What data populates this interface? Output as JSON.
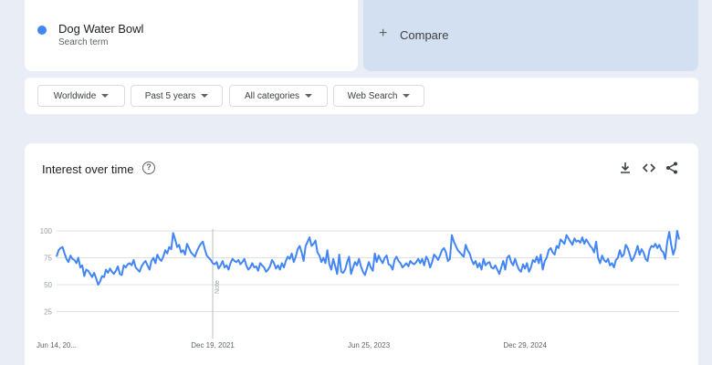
{
  "search_term": {
    "name": "Dog Water Bowl",
    "subtitle": "Search term",
    "color": "#4285f4"
  },
  "compare": {
    "plus": "+",
    "label": "Compare"
  },
  "filters": [
    {
      "label": "Worldwide"
    },
    {
      "label": "Past 5 years"
    },
    {
      "label": "All categories"
    },
    {
      "label": "Web Search"
    }
  ],
  "chart_panel": {
    "title": "Interest over time",
    "help_icon": "help-circle-icon",
    "tools": [
      "download-icon",
      "embed-code-icon",
      "share-icon"
    ]
  },
  "chart_data": {
    "type": "line",
    "title": "Interest over time",
    "xlabel": "",
    "ylabel": "",
    "ylim": [
      0,
      100
    ],
    "y_ticks": [
      25,
      50,
      75,
      100
    ],
    "x_tick_labels": [
      "Jun 14, 20...",
      "Dec 19, 2021",
      "Jun 25, 2023",
      "Dec 29, 2024"
    ],
    "x_tick_weeks": [
      0,
      79,
      158,
      237
    ],
    "note_label": "Note",
    "note_week": 79,
    "grid": true,
    "color": "#4285f4",
    "series": [
      {
        "values": [
          76,
          82,
          84,
          85,
          79,
          74,
          71,
          77,
          74,
          73,
          70,
          75,
          66,
          68,
          58,
          64,
          63,
          60,
          57,
          61,
          56,
          50,
          53,
          58,
          57,
          64,
          61,
          65,
          62,
          60,
          63,
          67,
          60,
          59,
          68,
          66,
          69,
          70,
          68,
          73,
          66,
          64,
          62,
          67,
          70,
          72,
          68,
          64,
          72,
          75,
          70,
          78,
          74,
          72,
          76,
          82,
          79,
          85,
          83,
          98,
          92,
          85,
          87,
          80,
          82,
          78,
          88,
          84,
          80,
          78,
          76,
          81,
          85,
          88,
          90,
          83,
          77,
          75,
          73,
          70,
          69,
          71,
          65,
          68,
          72,
          66,
          68,
          64,
          70,
          74,
          72,
          71,
          73,
          69,
          71,
          74,
          68,
          64,
          66,
          70,
          66,
          67,
          63,
          70,
          68,
          66,
          62,
          64,
          67,
          73,
          70,
          65,
          68,
          64,
          70,
          66,
          72,
          76,
          74,
          79,
          71,
          76,
          83,
          86,
          80,
          72,
          86,
          90,
          94,
          86,
          88,
          91,
          80,
          77,
          71,
          75,
          70,
          82,
          69,
          64,
          74,
          67,
          60,
          78,
          62,
          61,
          64,
          71,
          76,
          60,
          66,
          71,
          68,
          74,
          67,
          62,
          59,
          65,
          71,
          66,
          63,
          79,
          71,
          77,
          73,
          70,
          75,
          77,
          69,
          68,
          64,
          73,
          76,
          72,
          70,
          66,
          68,
          70,
          67,
          72,
          70,
          69,
          71,
          74,
          70,
          74,
          68,
          76,
          73,
          66,
          71,
          78,
          76,
          73,
          77,
          82,
          84,
          80,
          72,
          74,
          96,
          90,
          86,
          82,
          80,
          78,
          76,
          87,
          82,
          79,
          73,
          69,
          72,
          66,
          70,
          64,
          74,
          68,
          70,
          71,
          66,
          65,
          68,
          64,
          60,
          66,
          72,
          64,
          75,
          77,
          71,
          68,
          74,
          68,
          64,
          62,
          69,
          65,
          70,
          62,
          66,
          73,
          71,
          76,
          70,
          78,
          64,
          72,
          75,
          82,
          84,
          80,
          78,
          86,
          84,
          92,
          90,
          88,
          96,
          93,
          90,
          87,
          93,
          90,
          91,
          89,
          94,
          88,
          92,
          89,
          86,
          84,
          80,
          90,
          75,
          70,
          77,
          73,
          71,
          74,
          68,
          70,
          66,
          73,
          75,
          82,
          76,
          78,
          87,
          84,
          78,
          72,
          75,
          80,
          86,
          78,
          83,
          80,
          74,
          72,
          82,
          86,
          85,
          88,
          84,
          87,
          82,
          80,
          74,
          90,
          99,
          87,
          78,
          84,
          100,
          92
        ]
      }
    ]
  }
}
